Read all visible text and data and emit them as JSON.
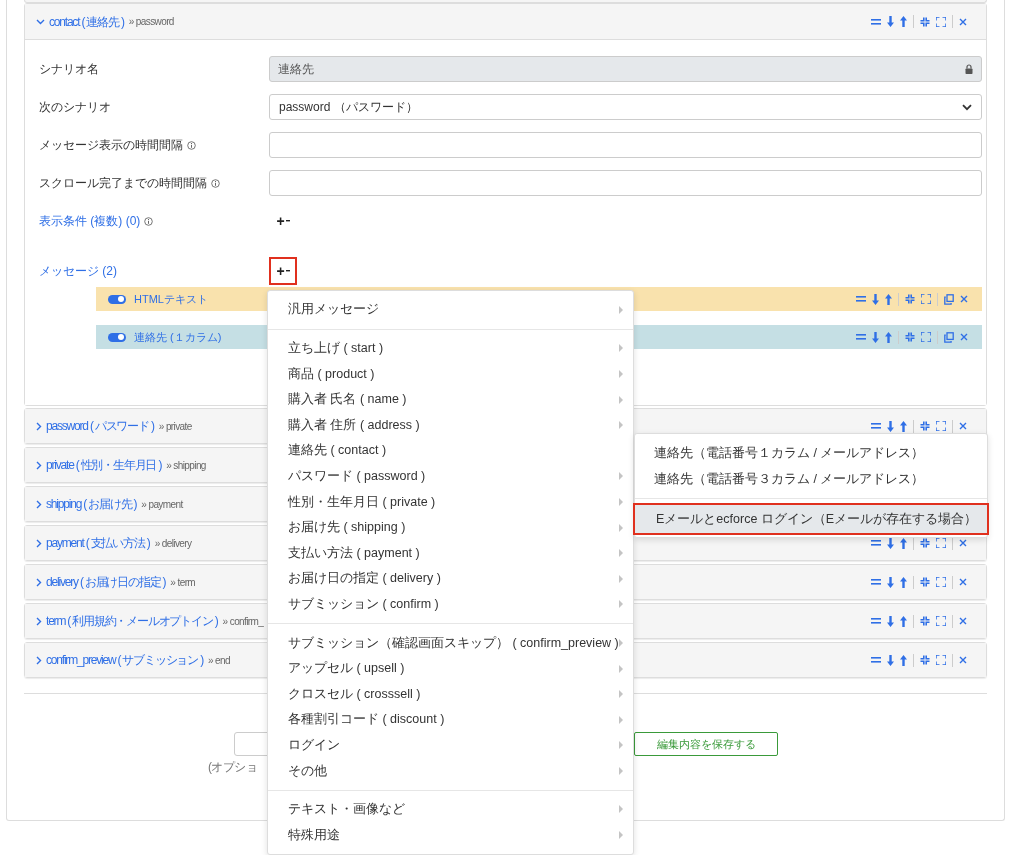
{
  "expanded_panel": {
    "title": "contact ( 連絡先 )",
    "next": "» password",
    "expanded": true,
    "fields": [
      {
        "kind": "locked",
        "label": "シナリオ名",
        "value": "連絡先",
        "info": false
      },
      {
        "kind": "select",
        "label": "次のシナリオ",
        "value": "password （パスワード）",
        "info": false
      },
      {
        "kind": "text",
        "label": "メッセージ表示の時間間隔",
        "info": true
      },
      {
        "kind": "text",
        "label": "スクロール完了までの時間間隔",
        "info": true
      }
    ],
    "conditions": {
      "label": "表示条件 (複数) (0)",
      "info": true,
      "add": "+",
      "annotated": false
    },
    "messages": {
      "label": "メッセージ (2)",
      "info": false,
      "add": "+",
      "annotated": true,
      "items": [
        {
          "title": "HTMLテキスト",
          "on": true,
          "color": "#f9e2ad"
        },
        {
          "title": "連絡先 (１カラム)",
          "on": true,
          "color": "#c5dfe4"
        }
      ]
    }
  },
  "panels": [
    {
      "title": "password ( パスワード )",
      "next": "» private",
      "expanded": false
    },
    {
      "title": "private ( 性別・生年月日 )",
      "next": "» shipping",
      "expanded": false
    },
    {
      "title": "shipping ( お届け先 )",
      "next": "» payment",
      "expanded": false
    },
    {
      "title": "payment ( 支払い方法 )",
      "next": "» delivery",
      "expanded": false
    },
    {
      "title": "delivery ( お届け日の指定 )",
      "next": "» term",
      "expanded": false
    },
    {
      "title": "term ( 利用規約・メールオプトイン )",
      "next": "» confirm_",
      "expanded": false
    },
    {
      "title": "confirm_preview ( サブミッション )",
      "next": "» end",
      "expanded": false
    }
  ],
  "save_area": {
    "note": "(オプショ",
    "button": "編集内容を保存する"
  },
  "menu": {
    "groups": [
      [
        {
          "label": "汎用メッセージ",
          "submenu": true
        }
      ],
      [
        {
          "label": "立ち上げ ( start )",
          "submenu": true
        },
        {
          "label": "商品 ( product )",
          "submenu": true
        },
        {
          "label": "購入者 氏名 ( name )",
          "submenu": true
        },
        {
          "label": "購入者 住所 ( address )",
          "submenu": true
        },
        {
          "label": "連絡先 ( contact )",
          "submenu": false
        },
        {
          "label": "パスワード ( password )",
          "submenu": true
        },
        {
          "label": "性別・生年月日 ( private )",
          "submenu": true
        },
        {
          "label": "お届け先 ( shipping )",
          "submenu": true
        },
        {
          "label": "支払い方法 ( payment )",
          "submenu": true
        },
        {
          "label": "お届け日の指定 ( delivery )",
          "submenu": true
        },
        {
          "label": "サブミッション ( confirm )",
          "submenu": true
        }
      ],
      [
        {
          "label": "サブミッション（確認画面スキップ） ( confirm_preview )",
          "submenu": true
        },
        {
          "label": "アップセル ( upsell )",
          "submenu": true
        },
        {
          "label": "クロスセル ( crosssell )",
          "submenu": true
        },
        {
          "label": "各種割引コード ( discount )",
          "submenu": true
        },
        {
          "label": "ログイン",
          "submenu": true
        },
        {
          "label": "その他",
          "submenu": true
        }
      ],
      [
        {
          "label": "テキスト・画像など",
          "submenu": true
        },
        {
          "label": "特殊用途",
          "submenu": true
        }
      ]
    ]
  },
  "submenu": {
    "groups": [
      [
        {
          "label": "連絡先（電話番号１カラム / メールアドレス）",
          "selected": false,
          "annotated": false
        },
        {
          "label": "連絡先（電話番号３カラム / メールアドレス）",
          "selected": false,
          "annotated": false
        }
      ],
      [
        {
          "label": "Eメールとecforce ログイン（Eメールが存在する場合）",
          "selected": true,
          "annotated": true
        }
      ]
    ]
  }
}
